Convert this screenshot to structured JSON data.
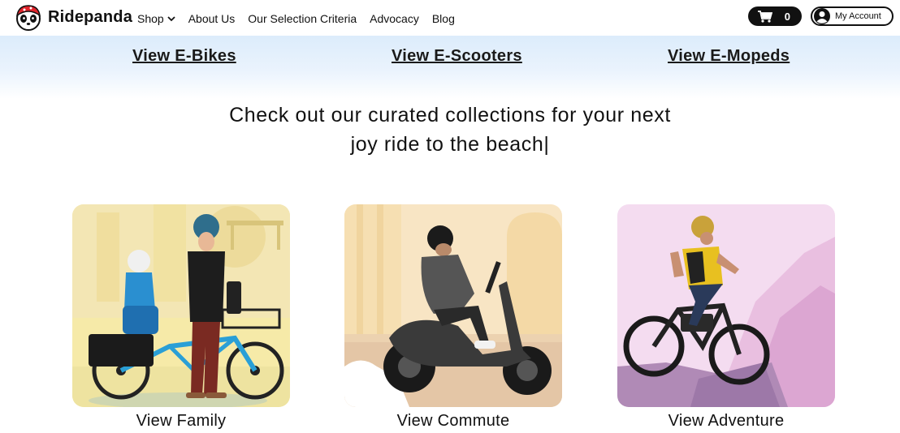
{
  "header": {
    "brand": "Ridepanda",
    "nav": [
      {
        "label": "Shop",
        "has_dropdown": true
      },
      {
        "label": "About Us"
      },
      {
        "label": "Our Selection Criteria"
      },
      {
        "label": "Advocacy"
      },
      {
        "label": "Blog"
      }
    ],
    "cart_count": "0",
    "account_label": "My Account"
  },
  "band_links": [
    "View E-Bikes",
    "View E-Scooters",
    "View E-Mopeds"
  ],
  "headline": {
    "line1": "Check out our curated collections for your next",
    "line2": "joy ride to the beach|"
  },
  "collections": [
    {
      "label": "View Family",
      "bg": "#f6e9a6"
    },
    {
      "label": "View Commute",
      "bg": "#f7e3c3"
    },
    {
      "label": "View Adventure",
      "bg": "#f1d3ec"
    }
  ],
  "colors": {
    "accent": "#111111",
    "band": "#dcecfb",
    "logo_red": "#e0242b"
  },
  "icons": [
    "panda-logo-icon",
    "chevron-down-icon",
    "cart-icon",
    "user-circle-icon"
  ]
}
